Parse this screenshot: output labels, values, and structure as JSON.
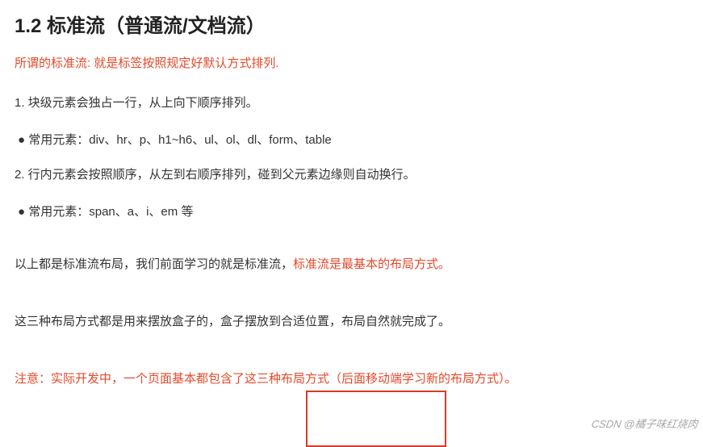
{
  "heading": "1.2 标准流（普通流/文档流）",
  "subtitle": "所谓的标准流: 就是标签按照规定好默认方式排列.",
  "item1": "1. 块级元素会独占一行，从上向下顺序排列。",
  "bullet1": "常用元素：div、hr、p、h1~h6、ul、ol、dl、form、table",
  "item2": "2. 行内元素会按照顺序，从左到右顺序排列，碰到父元素边缘则自动换行。",
  "bullet2": "常用元素：span、a、i、em 等",
  "summary_prefix": "以上都是标准流布局，我们前面学习的就是标准流，",
  "summary_highlight": "标准流是最基本的布局方式。",
  "note_three": "这三种布局方式都是用来摆放盒子的，盒子摆放到合适位置，布局自然就完成了。",
  "note_label": "注意：",
  "note_body": "实际开发中，一个页面基本都包含了这三种布局方式（后面移动端学习新的布局方式）。",
  "watermark": "CSDN @橘子味红烧肉",
  "colors": {
    "highlight": "#e24a2b",
    "text": "#333333",
    "box": "#d93a2a"
  }
}
